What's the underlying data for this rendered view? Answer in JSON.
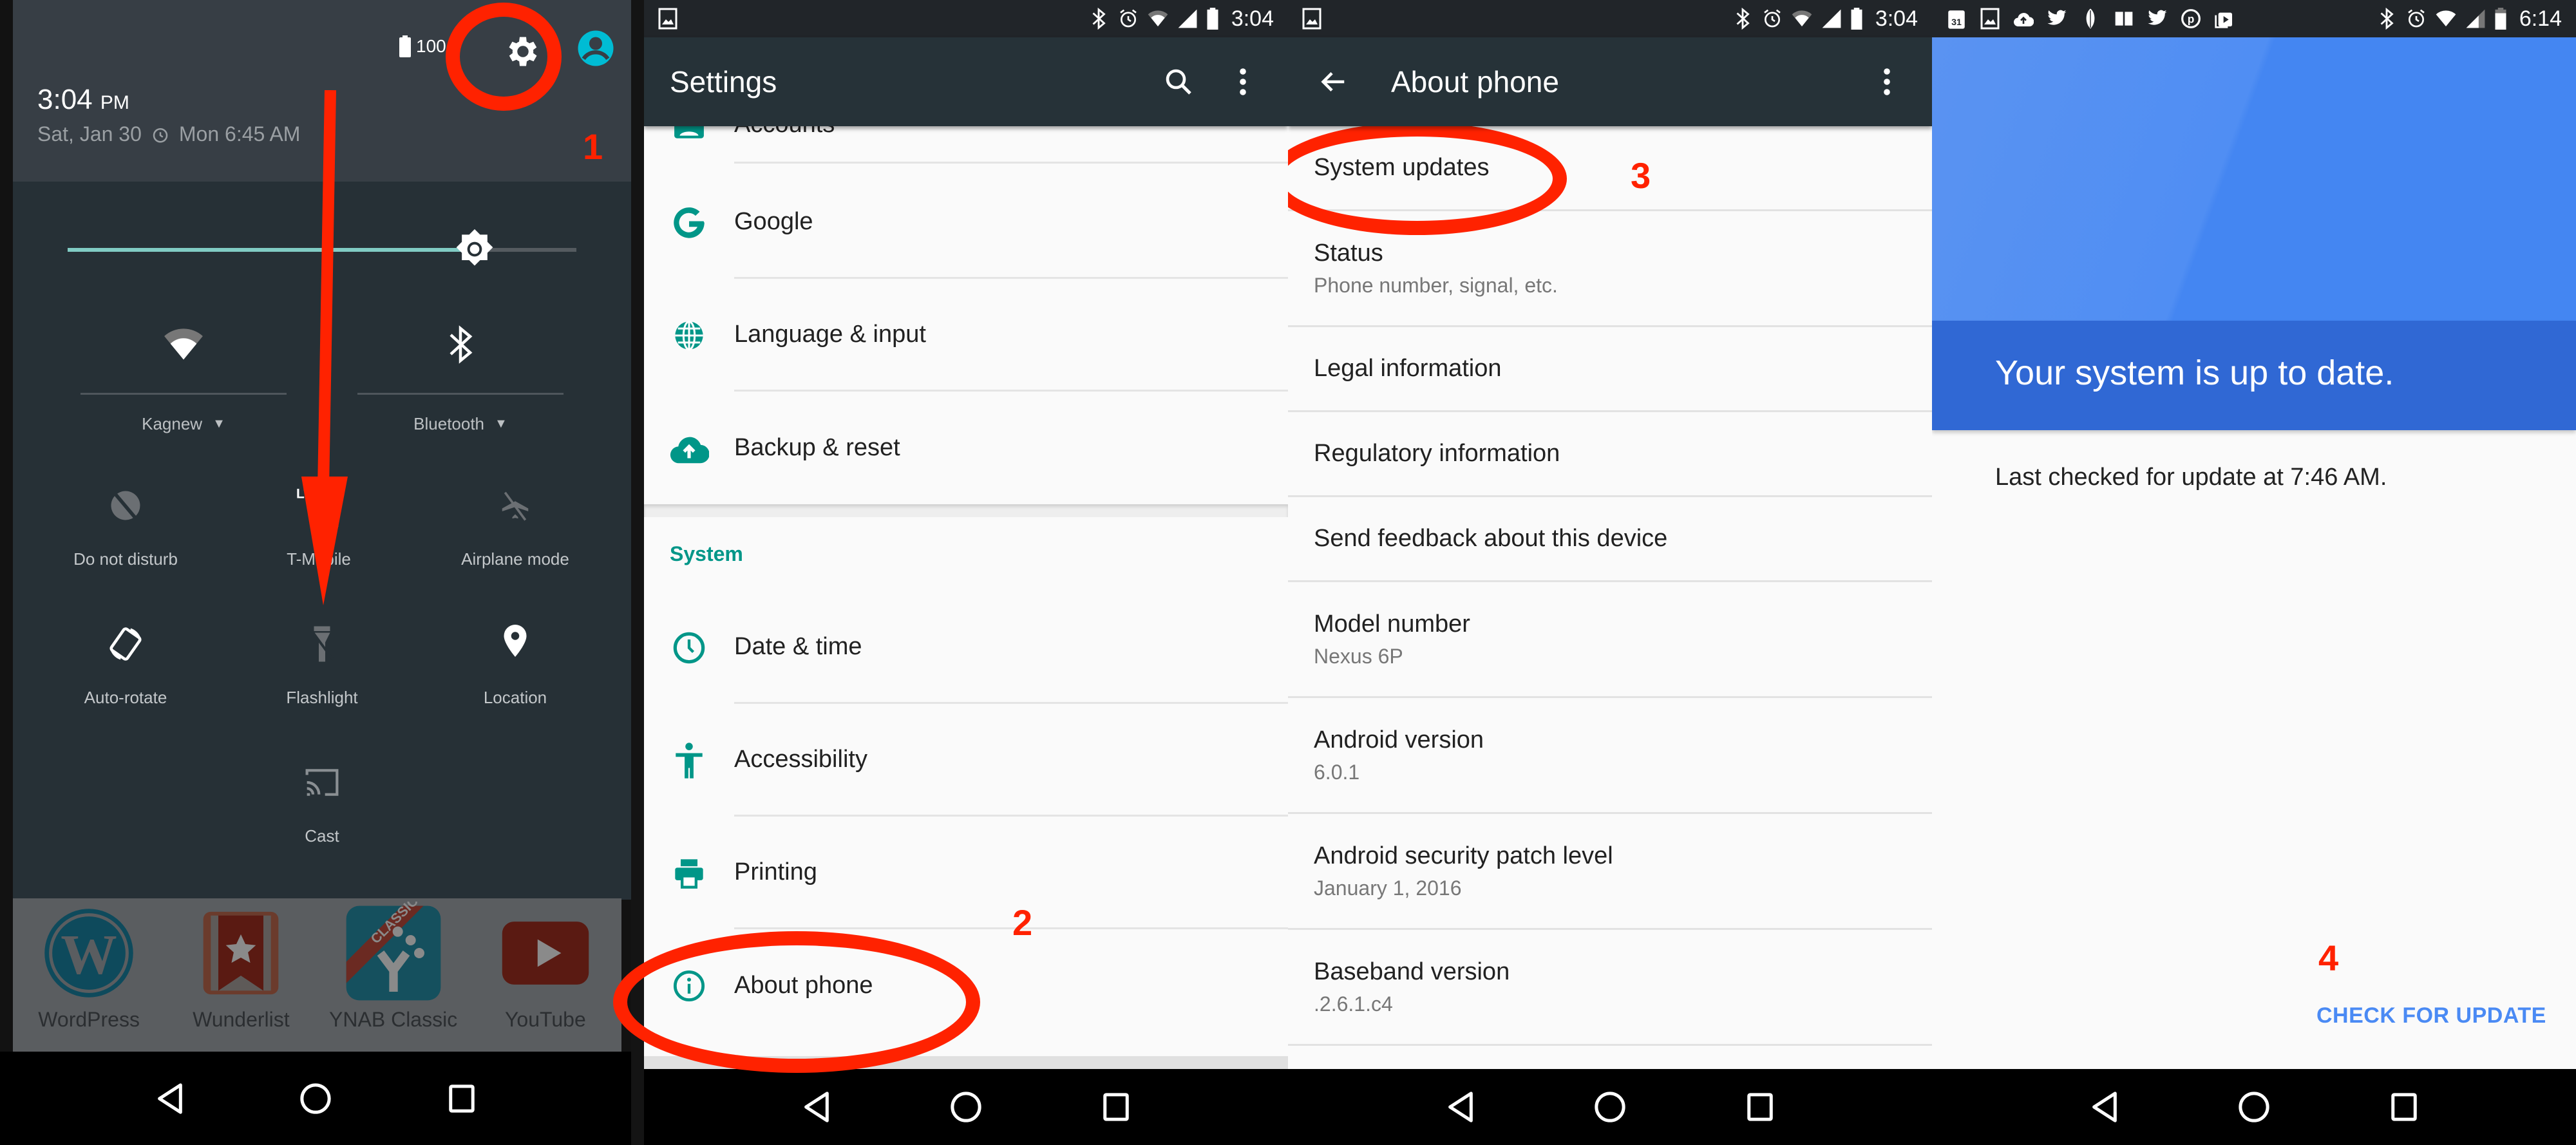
{
  "panels": {
    "quick_settings": {
      "battery_text": "100",
      "time": "3:04",
      "time_suffix": "PM",
      "date": "Sat, Jan 30",
      "alarm": "Mon 6:45 AM",
      "brightness_level": 0.8,
      "wifi_label": "Kagnew",
      "bluetooth_label": "Bluetooth",
      "tiles": [
        {
          "label": "Do not disturb",
          "icon": "do-not-disturb-off-icon",
          "active": false
        },
        {
          "label": "T-Mobile",
          "icon": "lte-signal-icon",
          "active": true
        },
        {
          "label": "Airplane mode",
          "icon": "airplane-off-icon",
          "active": false
        },
        {
          "label": "Auto-rotate",
          "icon": "auto-rotate-icon",
          "active": true
        },
        {
          "label": "Flashlight",
          "icon": "flashlight-off-icon",
          "active": false
        },
        {
          "label": "Location",
          "icon": "location-pin-icon",
          "active": true
        },
        {
          "label": "Cast",
          "icon": "cast-icon",
          "active": false
        }
      ],
      "dock_apps": [
        "WordPress",
        "Wunderlist",
        "YNAB Classic",
        "YouTube"
      ],
      "ynab_ribbon": "CLASSIC"
    },
    "settings": {
      "status_time": "3:04",
      "title": "Settings",
      "partial_item": "Accounts",
      "personal_items": [
        "Google",
        "Language & input",
        "Backup & reset"
      ],
      "section_header": "System",
      "system_items": [
        "Date & time",
        "Accessibility",
        "Printing",
        "About phone"
      ]
    },
    "about_phone": {
      "status_time": "3:04",
      "title": "About phone",
      "items": [
        {
          "title": "System updates",
          "subtitle": ""
        },
        {
          "title": "Status",
          "subtitle": "Phone number, signal, etc."
        },
        {
          "title": "Legal information",
          "subtitle": ""
        },
        {
          "title": "Regulatory information",
          "subtitle": ""
        },
        {
          "title": "Send feedback about this device",
          "subtitle": ""
        },
        {
          "title": "Model number",
          "subtitle": "Nexus 6P"
        },
        {
          "title": "Android version",
          "subtitle": "6.0.1"
        },
        {
          "title": "Android security patch level",
          "subtitle": "January 1, 2016"
        },
        {
          "title": "Baseband version",
          "subtitle": ".2.6.1.c4"
        }
      ]
    },
    "system_update": {
      "status_time": "6:14",
      "calendar_day": "31",
      "headline": "Your system is up to date.",
      "last_checked": "Last checked for update at 7:46 AM.",
      "check_button": "CHECK FOR UPDATE"
    }
  },
  "annotations": {
    "step1": "1",
    "step2": "2",
    "step3": "3",
    "step4": "4",
    "color": "#ff2200"
  },
  "colors": {
    "accent_teal": "#009688",
    "toolbar": "#263238",
    "update_blue": "#3068d4",
    "button_blue": "#4a8af4"
  }
}
